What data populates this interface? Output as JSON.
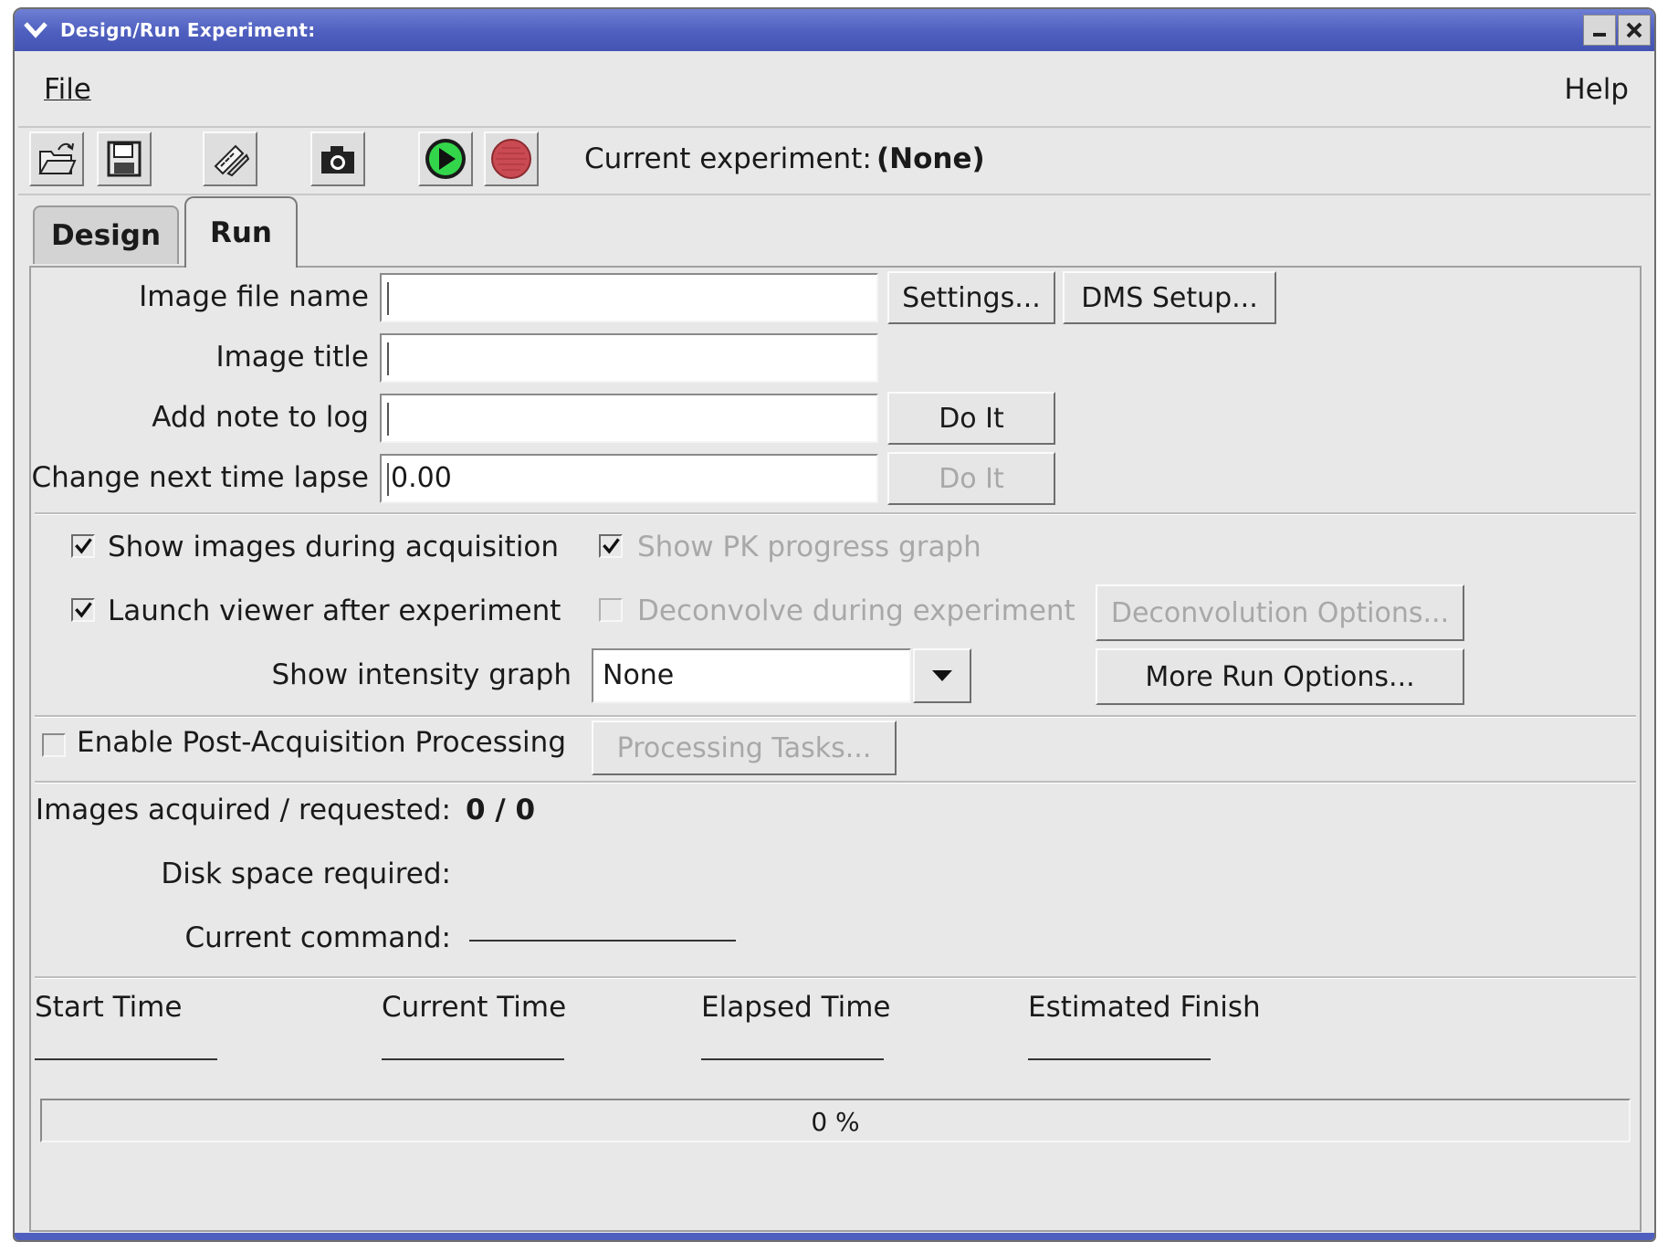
{
  "window": {
    "title": "Design/Run Experiment:"
  },
  "menu": {
    "file": "File",
    "help": "Help"
  },
  "toolbar": {
    "buttons": [
      "open-folder-icon",
      "save-icon",
      "ruler-pencil-icon",
      "camera-icon",
      "run-play-icon",
      "stop-record-icon"
    ],
    "current_experiment_label": "Current experiment:",
    "current_experiment_value": "(None)"
  },
  "tabs": {
    "design": "Design",
    "run": "Run",
    "active": "Run"
  },
  "run": {
    "image_file_name": {
      "label": "Image file name",
      "value": ""
    },
    "image_title": {
      "label": "Image title",
      "value": ""
    },
    "add_note": {
      "label": "Add note to log",
      "value": ""
    },
    "time_lapse": {
      "label": "Change next time lapse",
      "value": "0.00"
    },
    "settings_button": "Settings...",
    "dms_setup_button": "DMS Setup...",
    "do_it_button": "Do It",
    "do_it_disabled_button": "Do It",
    "show_images": {
      "label": "Show images during acquisition",
      "checked": true
    },
    "show_pk_graph": {
      "label": "Show PK progress graph",
      "checked": true,
      "enabled": false
    },
    "launch_viewer": {
      "label": "Launch viewer after experiment",
      "checked": true
    },
    "deconvolve": {
      "label": "Deconvolve during experiment",
      "checked": false,
      "enabled": false
    },
    "deconvolution_options_button": "Deconvolution Options...",
    "intensity_graph": {
      "label": "Show intensity graph",
      "selected": "None"
    },
    "more_run_options_button": "More Run Options...",
    "post_processing": {
      "label": "Enable Post-Acquisition Processing",
      "checked": false
    },
    "processing_tasks_button": "Processing Tasks...",
    "images_acquired": {
      "label": "Images acquired / requested:",
      "value": "0 / 0"
    },
    "disk_space": {
      "label": "Disk space required:",
      "value": ""
    },
    "current_command": {
      "label": "Current command:",
      "value": ""
    },
    "times": {
      "start_label": "Start Time",
      "current_label": "Current Time",
      "elapsed_label": "Elapsed Time",
      "finish_label": "Estimated Finish"
    },
    "progress": {
      "percent": 0,
      "text": "0 %"
    }
  },
  "colors": {
    "titlebar": "#4f5fbf",
    "disabled_text": "#a8a8a8",
    "panel_bg": "#e8e8e8"
  }
}
